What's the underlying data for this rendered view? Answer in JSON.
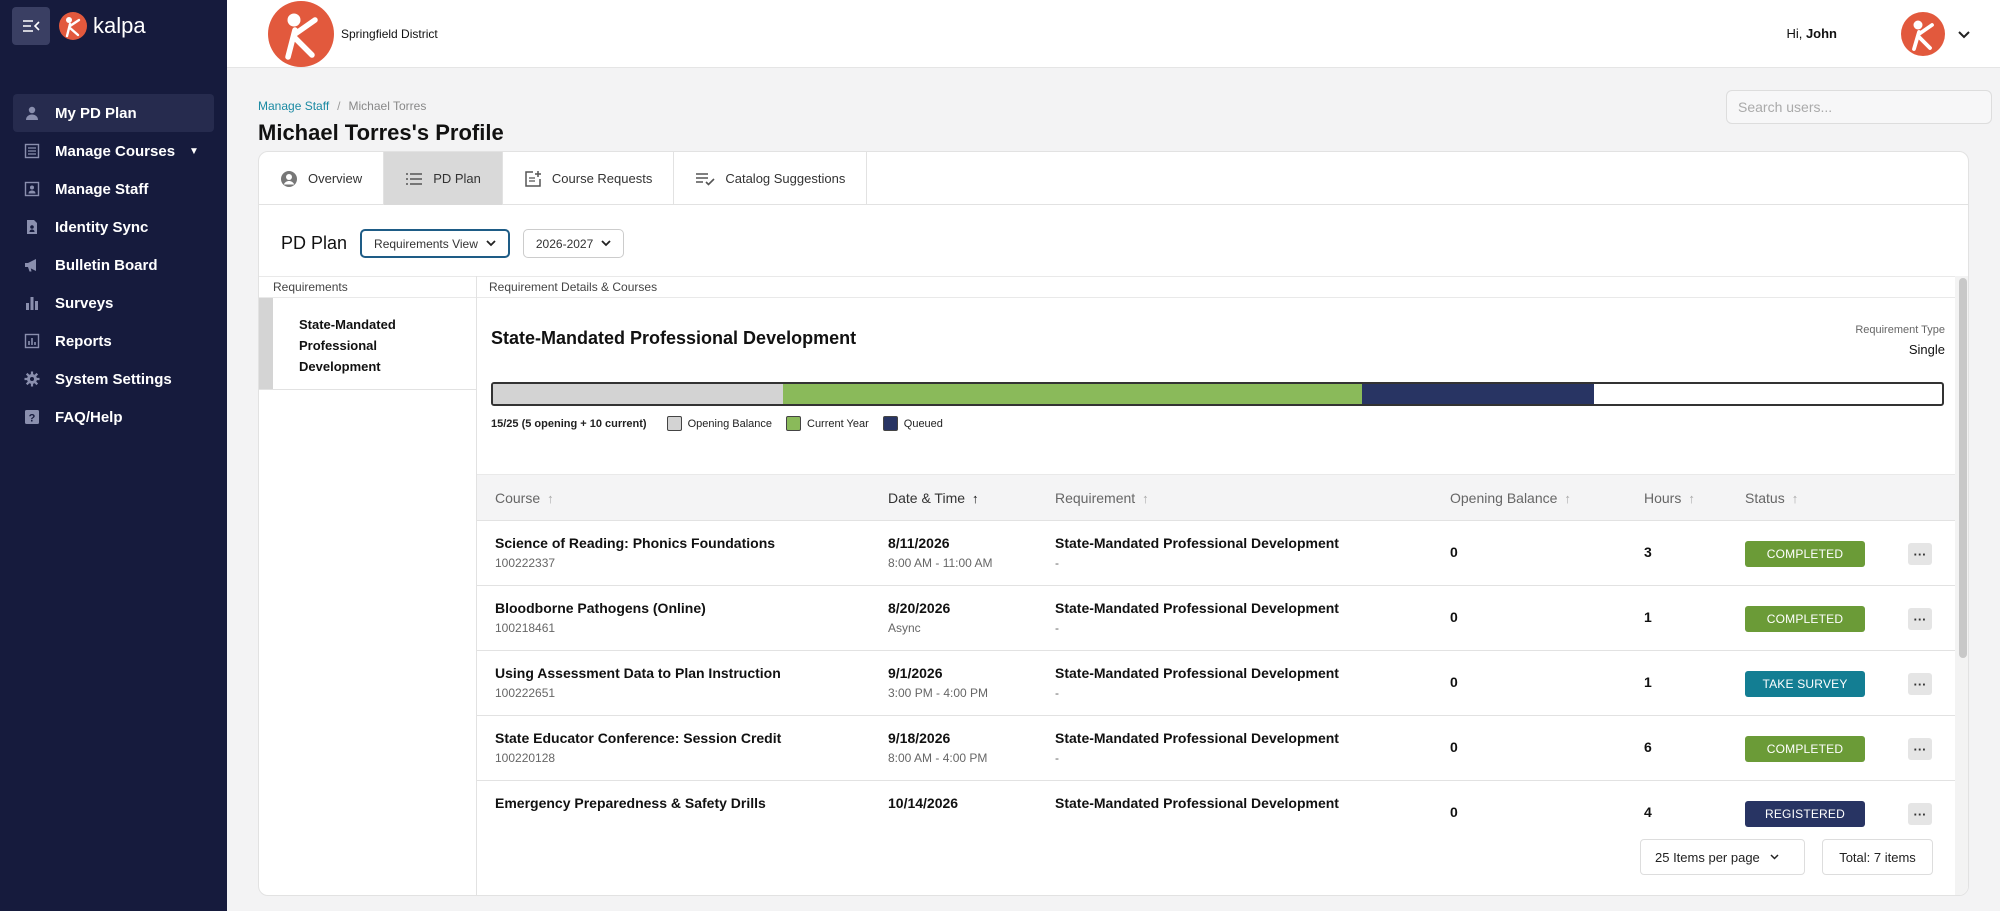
{
  "sidebar": {
    "logo_text": "kalpa",
    "items": [
      {
        "label": "My PD Plan",
        "icon": "person-icon"
      },
      {
        "label": "Manage Courses",
        "icon": "course-list-icon"
      },
      {
        "label": "Manage Staff",
        "icon": "staff-icon"
      },
      {
        "label": "Identity Sync",
        "icon": "id-file-icon"
      },
      {
        "label": "Bulletin Board",
        "icon": "megaphone-icon"
      },
      {
        "label": "Surveys",
        "icon": "bar-chart-icon"
      },
      {
        "label": "Reports",
        "icon": "report-icon"
      },
      {
        "label": "System Settings",
        "icon": "gear-icon"
      },
      {
        "label": "FAQ/Help",
        "icon": "help-icon"
      }
    ]
  },
  "header": {
    "district_name": "Springfield District",
    "greeting_prefix": "Hi, ",
    "greeting_name": "John",
    "brand_color": "#e2593d"
  },
  "breadcrumb": {
    "parent": "Manage Staff",
    "separator": "/",
    "current": "Michael Torres"
  },
  "page_title": "Michael Torres's Profile",
  "search": {
    "placeholder": "Search users..."
  },
  "tabs": [
    {
      "label": "Overview",
      "icon": "user-circle-icon"
    },
    {
      "label": "PD Plan",
      "icon": "list-icon"
    },
    {
      "label": "Course Requests",
      "icon": "add-note-icon"
    },
    {
      "label": "Catalog Suggestions",
      "icon": "checklist-icon"
    }
  ],
  "pd_plan": {
    "label": "PD Plan",
    "view_select": "Requirements View",
    "year_select": "2026-2027"
  },
  "requirements": {
    "header": "Requirements",
    "items": [
      {
        "label": "State-Mandated Professional Development"
      }
    ]
  },
  "detail": {
    "header": "Requirement Details & Courses",
    "title": "State-Mandated Professional Development",
    "req_type_label": "Requirement Type",
    "req_type_value": "Single",
    "progress": {
      "total": 25,
      "opening": 5,
      "current": 10,
      "queued": 4,
      "summary": "15/25 (5 opening + 10 current)",
      "legend": [
        {
          "label": "Opening Balance",
          "color": "#d3d3d3"
        },
        {
          "label": "Current Year",
          "color": "#8aba5a"
        },
        {
          "label": "Queued",
          "color": "#283463"
        }
      ]
    }
  },
  "table": {
    "columns": [
      "Course",
      "Date & Time",
      "Requirement",
      "Opening Balance",
      "Hours",
      "Status"
    ],
    "rows": [
      {
        "course": "Science of Reading: Phonics Foundations",
        "code": "100222337",
        "date": "8/11/2026",
        "time": "8:00 AM - 11:00 AM",
        "requirement": "State-Mandated Professional Development",
        "req_sub": "-",
        "opening": "0",
        "hours": "3",
        "status": "COMPLETED",
        "status_color": "#6b9b37"
      },
      {
        "course": "Bloodborne Pathogens (Online)",
        "code": "100218461",
        "date": "8/20/2026",
        "time": "Async",
        "requirement": "State-Mandated Professional Development",
        "req_sub": "-",
        "opening": "0",
        "hours": "1",
        "status": "COMPLETED",
        "status_color": "#6b9b37"
      },
      {
        "course": "Using Assessment Data to Plan Instruction",
        "code": "100222651",
        "date": "9/1/2026",
        "time": "3:00 PM - 4:00 PM",
        "requirement": "State-Mandated Professional Development",
        "req_sub": "-",
        "opening": "0",
        "hours": "1",
        "status": "TAKE SURVEY",
        "status_color": "#137e93"
      },
      {
        "course": "State Educator Conference: Session Credit",
        "code": "100220128",
        "date": "9/18/2026",
        "time": "8:00 AM - 4:00 PM",
        "requirement": "State-Mandated Professional Development",
        "req_sub": "-",
        "opening": "0",
        "hours": "6",
        "status": "COMPLETED",
        "status_color": "#6b9b37"
      },
      {
        "course": "Emergency Preparedness & Safety Drills",
        "code": "",
        "date": "10/14/2026",
        "time": "",
        "requirement": "State-Mandated Professional Development",
        "req_sub": "",
        "opening": "0",
        "hours": "4",
        "status": "REGISTERED",
        "status_color": "#283463"
      }
    ]
  },
  "pagination": {
    "per_page": "25 Items per page",
    "total": "Total: 7 items"
  }
}
